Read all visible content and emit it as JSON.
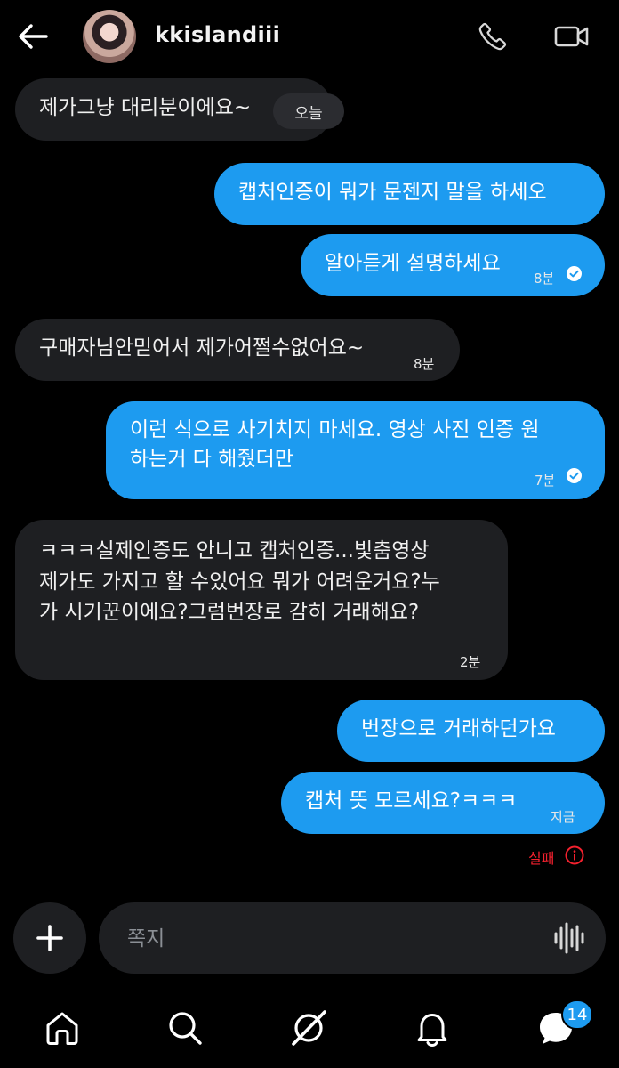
{
  "header": {
    "username": "kkislandiii"
  },
  "day_chip": "오늘",
  "messages": [
    {
      "side": "in",
      "lines": [
        "제가그냥 대리분이에요~"
      ],
      "time": ""
    },
    {
      "side": "out",
      "lines": [
        "캡처인증이 뭐가 문젠지 말을 하세오"
      ],
      "time": ""
    },
    {
      "side": "out",
      "lines": [
        "알아듣게 설명하세요"
      ],
      "time": "8분",
      "read": true
    },
    {
      "side": "in",
      "lines": [
        "구매자님안믿어서 제가어쩔수없어요~"
      ],
      "time": "8분"
    },
    {
      "side": "out",
      "lines": [
        "이런 식으로 사기치지 마세요. 영상 사진 인증 원",
        "하는거 다 해줬더만"
      ],
      "time": "7분",
      "read": true
    },
    {
      "side": "in",
      "lines": [
        "ㅋㅋㅋ실제인증도 안니고 캡처인증...빛춤영상",
        "제가도 가지고 할 수있어요 뭐가 어려운거요?누",
        "가 시기꾼이에요?그럼번장로 감히 거래해요?"
      ],
      "time": "2분"
    },
    {
      "side": "out",
      "lines": [
        "번장으로 거래하던가요"
      ],
      "time": ""
    },
    {
      "side": "out",
      "lines": [
        "캡처 뜻 모르세요?ㅋㅋㅋ"
      ],
      "time": "지금"
    }
  ],
  "status": {
    "failed_label": "실패"
  },
  "composer": {
    "placeholder": "쪽지"
  },
  "nav": {
    "messages_badge": "14"
  },
  "colors": {
    "background": "#000000",
    "outgoing_bubble": "#1d9bf0",
    "incoming_bubble": "#1e1f22",
    "error": "#f4212e"
  }
}
